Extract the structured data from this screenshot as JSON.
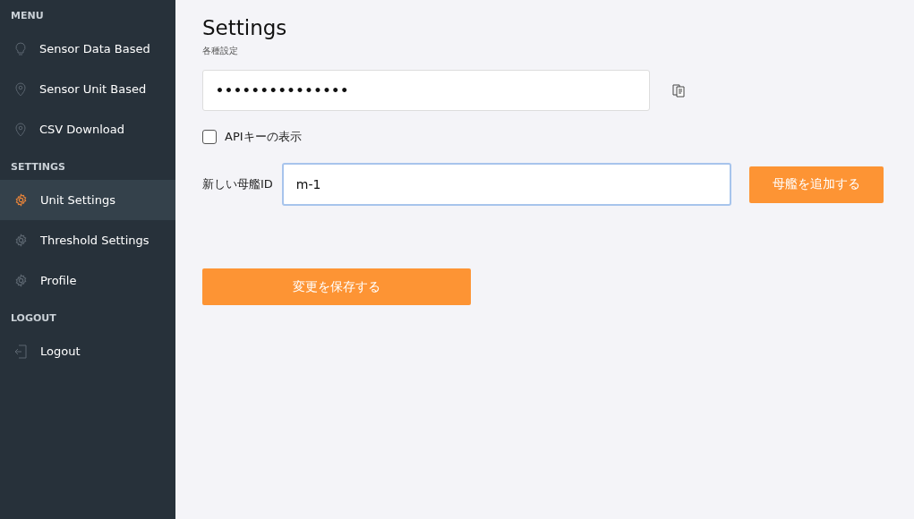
{
  "sidebar": {
    "sections": [
      {
        "title": "MENU",
        "items": [
          {
            "label": "Sensor Data Based",
            "kind": "bulb",
            "selected": false
          },
          {
            "label": "Sensor Unit Based",
            "kind": "pin",
            "selected": false
          },
          {
            "label": "CSV Download",
            "kind": "pin",
            "selected": false
          }
        ]
      },
      {
        "title": "SETTINGS",
        "items": [
          {
            "label": "Unit Settings",
            "kind": "gear",
            "selected": true
          },
          {
            "label": "Threshold Settings",
            "kind": "gear",
            "selected": false
          },
          {
            "label": "Profile",
            "kind": "gear",
            "selected": false
          }
        ]
      },
      {
        "title": "LOGOUT",
        "items": [
          {
            "label": "Logout",
            "kind": "exit",
            "selected": false
          }
        ]
      }
    ]
  },
  "page": {
    "title": "Settings",
    "subtitle": "各種設定"
  },
  "api_key": {
    "value": "•••••••••••••••",
    "show_label": "APIキーの表示",
    "show_checked": false
  },
  "new_ship": {
    "label": "新しい母艦ID",
    "value": "m-1",
    "focused": true,
    "button": "母艦を追加する"
  },
  "save_button": "変更を保存する"
}
